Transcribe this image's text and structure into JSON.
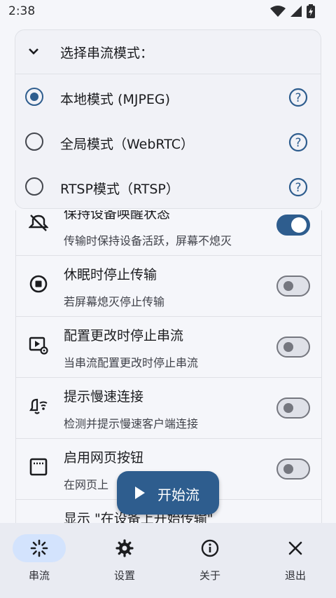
{
  "status_bar": {
    "time": "2:38"
  },
  "mode_selector": {
    "title": "选择串流模式：",
    "options": [
      {
        "label": "本地模式 (MJPEG)",
        "selected": true
      },
      {
        "label": "全局模式（WebRTC）",
        "selected": false
      },
      {
        "label": "RTSP模式（RTSP）",
        "selected": false
      }
    ]
  },
  "settings": [
    {
      "title": "保持设备唤醒状态",
      "description": "传输时保持设备活跃，屏幕不熄灭",
      "enabled": true,
      "icon": "sleep-off-icon"
    },
    {
      "title": "休眠时停止传输",
      "description": "若屏幕熄灭停止传输",
      "enabled": false,
      "icon": "stop-circle-icon"
    },
    {
      "title": "配置更改时停止串流",
      "description": "当串流配置更改时停止串流",
      "enabled": false,
      "icon": "video-settings-icon"
    },
    {
      "title": "提示慢速连接",
      "description": "检测并提示慢速客户端连接",
      "enabled": false,
      "icon": "notification-wifi-icon"
    },
    {
      "title": "启用网页按钮",
      "description": "在网页上",
      "enabled": false,
      "icon": "web-window-icon"
    },
    {
      "title": "显示 \"在设备上开始传输\"",
      "description": "",
      "enabled": false,
      "icon": ""
    }
  ],
  "fab": {
    "label": "开始流"
  },
  "bottom_nav": [
    {
      "label": "串流",
      "icon": "stream-icon",
      "active": true
    },
    {
      "label": "设置",
      "icon": "gear-icon",
      "active": false
    },
    {
      "label": "关于",
      "icon": "info-icon",
      "active": false
    },
    {
      "label": "退出",
      "icon": "close-icon",
      "active": false
    }
  ],
  "colors": {
    "primary": "#2e5d8e",
    "nav_active_pill": "#d3e3fd",
    "background": "#f5f6fa"
  }
}
